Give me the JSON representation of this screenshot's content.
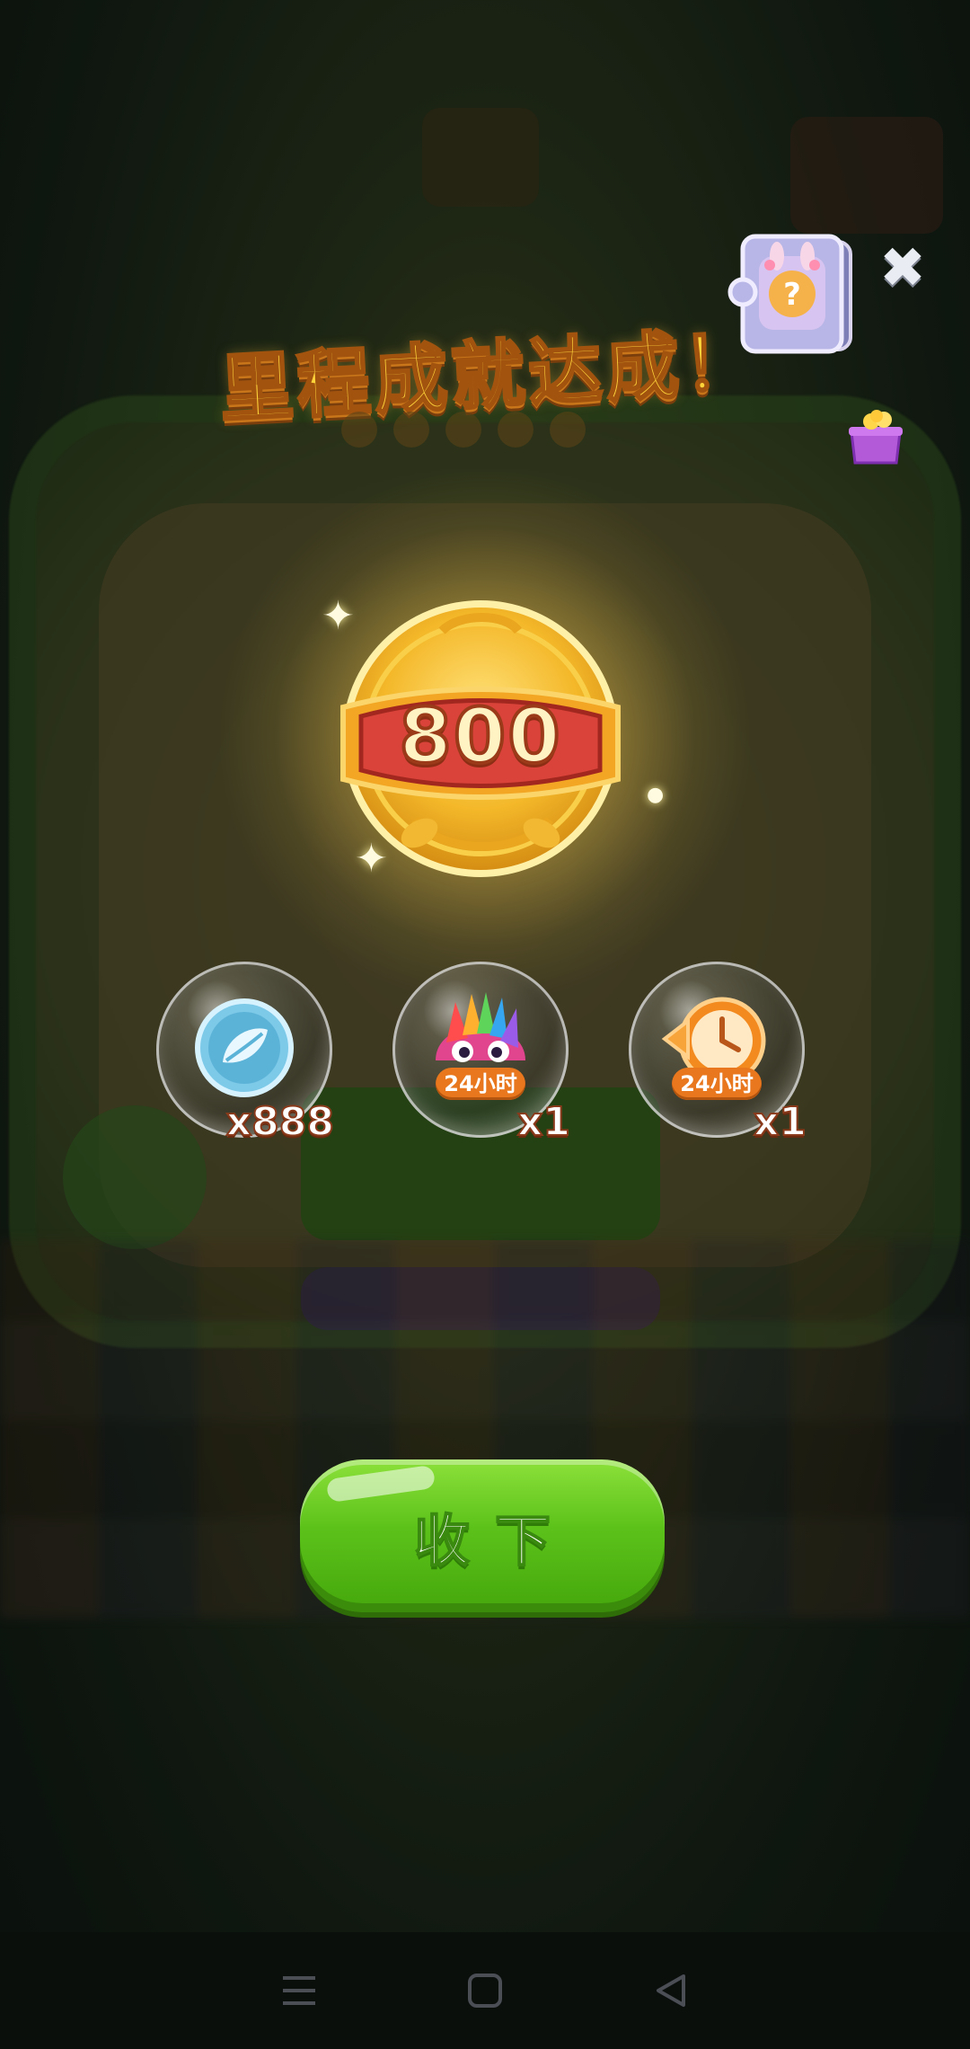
{
  "title": "里程成就达成！",
  "milestone": {
    "value": "800"
  },
  "rewards": [
    {
      "name": "coin",
      "icon": "leaf-coin-icon",
      "quantity": "x888",
      "tag": ""
    },
    {
      "name": "rainbow-mask",
      "icon": "rainbow-mask-icon",
      "quantity": "x1",
      "tag": "24小时"
    },
    {
      "name": "clock-boost",
      "icon": "clock-icon",
      "quantity": "x1",
      "tag": "24小时"
    }
  ],
  "collect_button": {
    "label": "收下"
  },
  "top_right": {
    "close_icon": "close-icon",
    "puzzle_icon": "puzzle-card-icon",
    "gift_icon": "gift-box-icon"
  },
  "navbar": {
    "items": [
      "menu-icon",
      "home-icon",
      "back-icon"
    ]
  },
  "colors": {
    "title": "#ffd43a",
    "button": "#5cc21a",
    "medal": "#f3b824",
    "badge": "#d9433a"
  }
}
